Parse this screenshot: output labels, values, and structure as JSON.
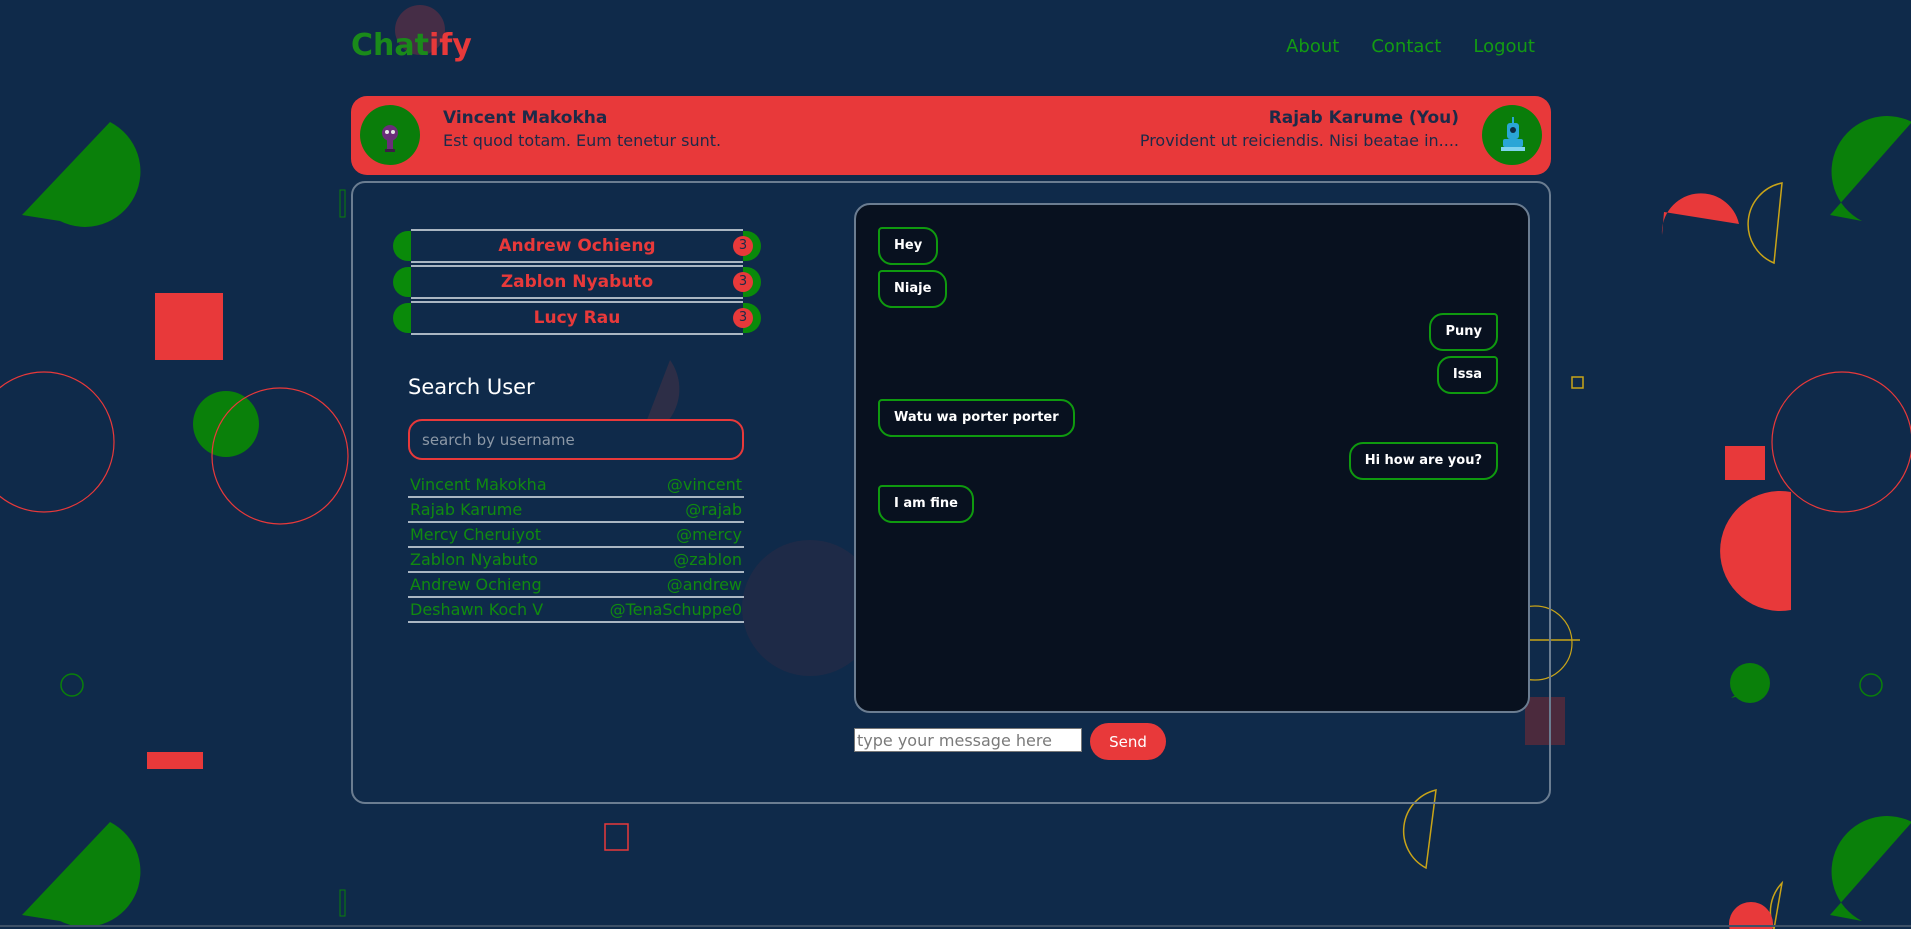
{
  "header": {
    "logo_part1": "Chat",
    "logo_part2": "ify",
    "nav": [
      "About",
      "Contact",
      "Logout"
    ]
  },
  "banner": {
    "left_name": "Vincent Makokha",
    "left_message": "Est quod totam. Eum tenetur sunt.",
    "right_name": "Rajab Karume (You)",
    "right_message": "Provident ut reiciendis. Nisi beatae in...."
  },
  "chats": [
    {
      "name": "Andrew Ochieng",
      "unread": "3"
    },
    {
      "name": "Zablon Nyabuto",
      "unread": "3"
    },
    {
      "name": "Lucy Rau",
      "unread": "3"
    }
  ],
  "search": {
    "title": "Search User",
    "placeholder": "search by username"
  },
  "users": [
    {
      "name": "Vincent Makokha",
      "handle": "@vincent"
    },
    {
      "name": "Rajab Karume",
      "handle": "@rajab"
    },
    {
      "name": "Mercy Cheruiyot",
      "handle": "@mercy"
    },
    {
      "name": "Zablon Nyabuto",
      "handle": "@zablon"
    },
    {
      "name": "Andrew Ochieng",
      "handle": "@andrew"
    },
    {
      "name": "Deshawn Koch V",
      "handle": "@TenaSchuppe0"
    }
  ],
  "messages": [
    {
      "text": "Hey",
      "side": "left"
    },
    {
      "text": "Niaje",
      "side": "left"
    },
    {
      "text": "Puny",
      "side": "right"
    },
    {
      "text": "Issa",
      "side": "right"
    },
    {
      "text": "Watu wa porter porter",
      "side": "left"
    },
    {
      "text": "Hi how are you?",
      "side": "right"
    },
    {
      "text": "I am fine",
      "side": "left"
    }
  ],
  "composer": {
    "placeholder": "type your message here",
    "send_label": "Send"
  },
  "colors": {
    "background": "#0f2a4a",
    "accent_red": "#e8393a",
    "accent_green": "#0a8a0a"
  }
}
